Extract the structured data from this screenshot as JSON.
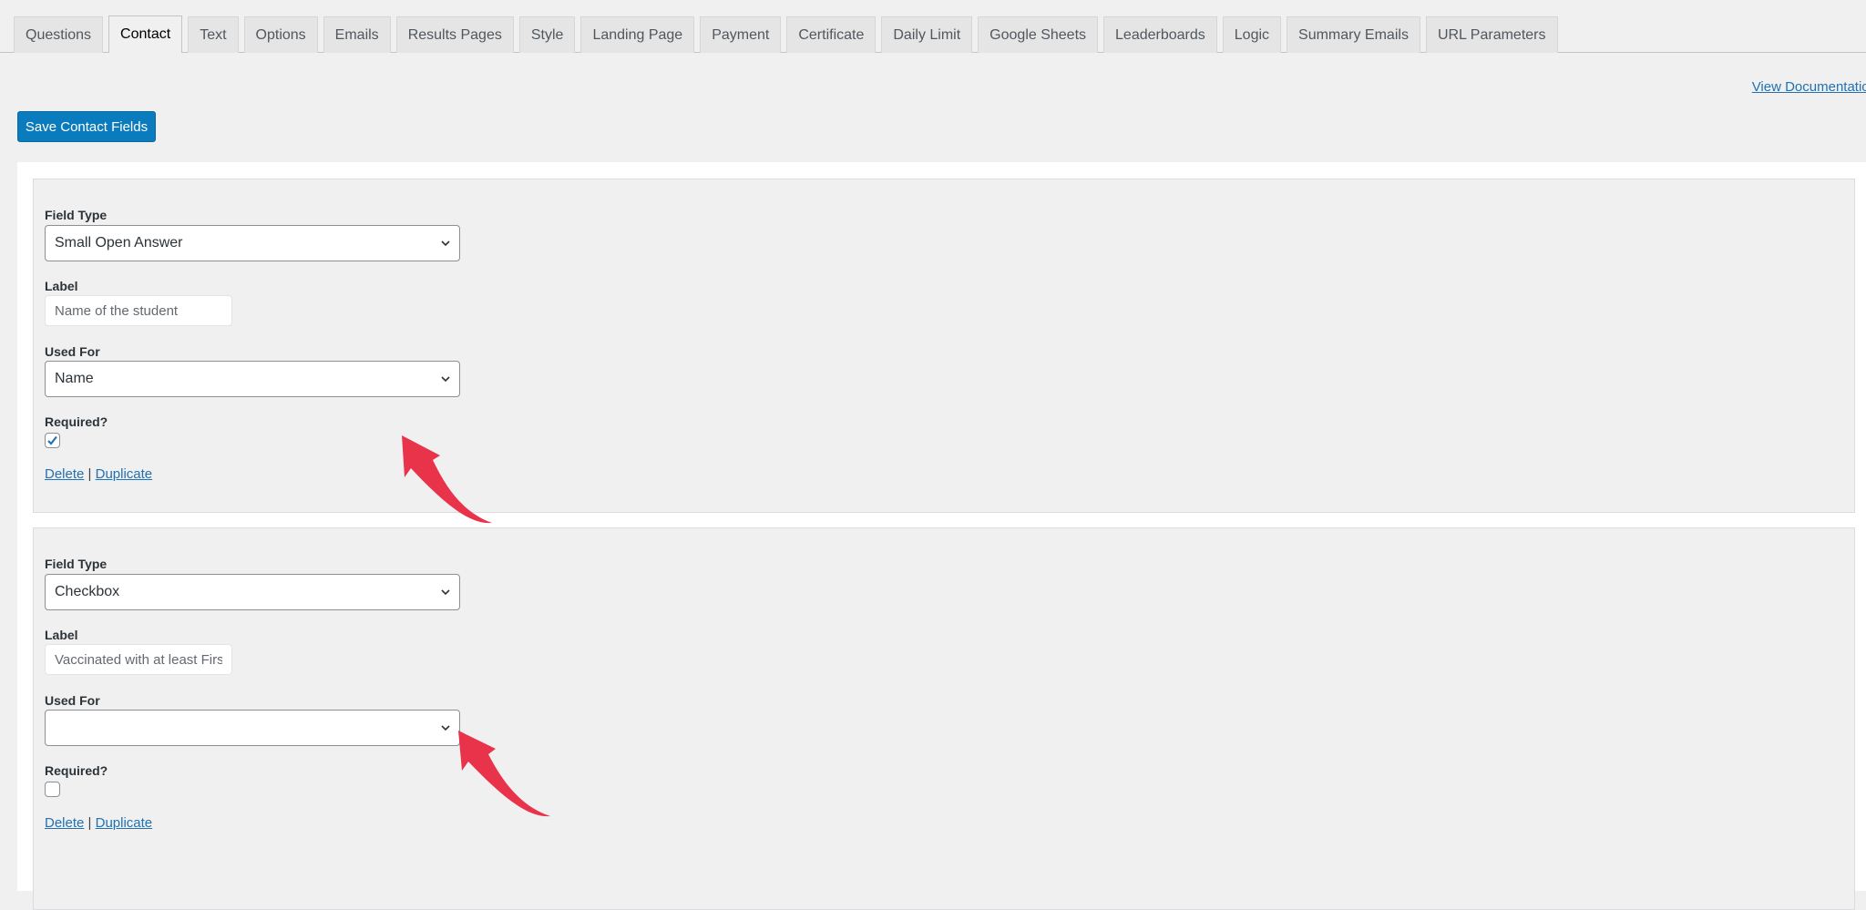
{
  "tabs": [
    {
      "label": "Questions",
      "active": false
    },
    {
      "label": "Contact",
      "active": true
    },
    {
      "label": "Text",
      "active": false
    },
    {
      "label": "Options",
      "active": false
    },
    {
      "label": "Emails",
      "active": false
    },
    {
      "label": "Results Pages",
      "active": false
    },
    {
      "label": "Style",
      "active": false
    },
    {
      "label": "Landing Page",
      "active": false
    },
    {
      "label": "Payment",
      "active": false
    },
    {
      "label": "Certificate",
      "active": false
    },
    {
      "label": "Daily Limit",
      "active": false
    },
    {
      "label": "Google Sheets",
      "active": false
    },
    {
      "label": "Leaderboards",
      "active": false
    },
    {
      "label": "Logic",
      "active": false
    },
    {
      "label": "Summary Emails",
      "active": false
    },
    {
      "label": "URL Parameters",
      "active": false
    }
  ],
  "toolbar": {
    "view_documentation_label": "View Documentation",
    "save_label": "Save Contact Fields"
  },
  "labels": {
    "field_type": "Field Type",
    "label": "Label",
    "used_for": "Used For",
    "required": "Required?",
    "delete": "Delete",
    "separator": "|",
    "duplicate": "Duplicate"
  },
  "fields": [
    {
      "field_type": "Small Open Answer",
      "label_value": "Name of the student",
      "used_for": "Name",
      "required": true
    },
    {
      "field_type": "Checkbox",
      "label_value": "Vaccinated with at least First Dose",
      "label_visible": "Vaccinated with at least Fir",
      "used_for": "",
      "required": false
    }
  ],
  "colors": {
    "accent": "#2271b1",
    "button": "#0a7bbd",
    "annotation_arrow": "#e8334a",
    "page_bg": "#f0f0f1"
  },
  "icons": {
    "select_chevron": "chevron-down-icon",
    "checkmark": "checkmark-icon",
    "annotation": "red-curved-arrow-icon"
  }
}
